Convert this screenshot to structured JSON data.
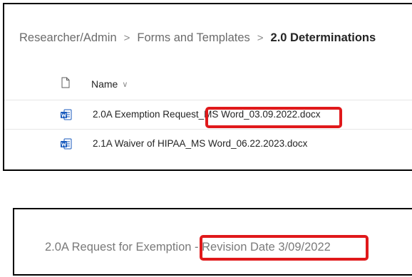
{
  "breadcrumb": {
    "items": [
      "Researcher/Admin",
      "Forms and Templates",
      "2.0 Determinations"
    ],
    "separator": ">"
  },
  "list": {
    "header": {
      "name_label": "Name",
      "sort_glyph": "∨"
    },
    "files": [
      {
        "name": "2.0A Exemption Request_MS Word_03.09.2022.docx",
        "icon": "word-icon"
      },
      {
        "name": "2.1A Waiver of HIPAA_MS Word_06.22.2023.docx",
        "icon": "word-icon"
      }
    ]
  },
  "document": {
    "title": "2.0A Request for Exemption - Revision Date 3/09/2022"
  },
  "colors": {
    "highlight": "#e0191b",
    "word_blue": "#185abd",
    "panel_border": "#000000"
  }
}
